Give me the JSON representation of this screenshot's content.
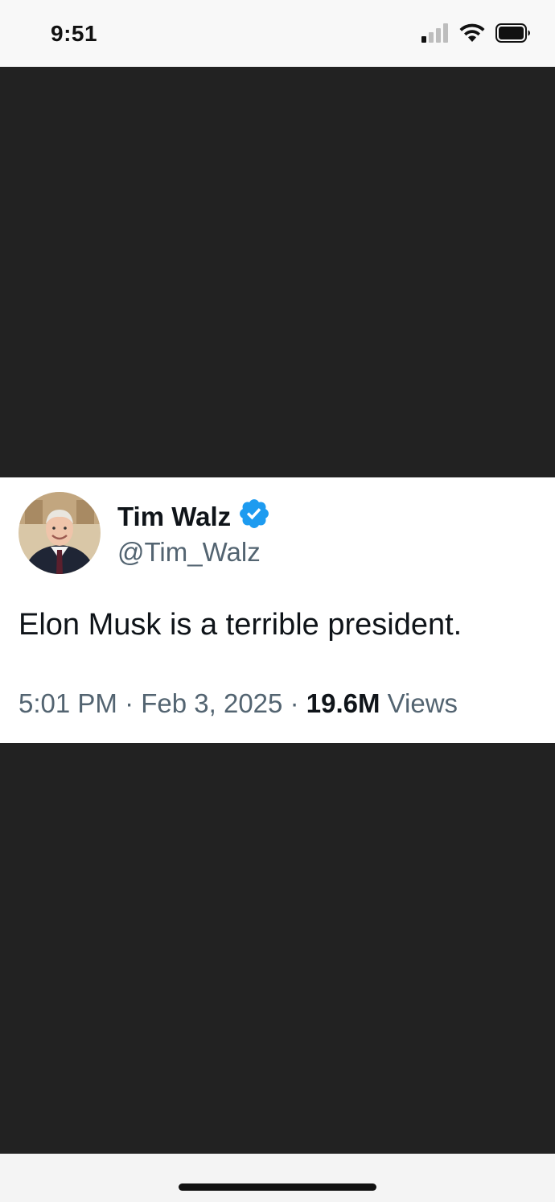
{
  "status_bar": {
    "time": "9:51",
    "signal_icon": "cellular-signal-icon",
    "wifi_icon": "wifi-icon",
    "battery_icon": "battery-icon"
  },
  "tweet": {
    "display_name": "Tim Walz",
    "verified_icon": "verified-badge-icon",
    "verified_color": "#1d9bf0",
    "handle": "@Tim_Walz",
    "text": "Elon Musk is a terrible president.",
    "time": "5:01 PM",
    "separator": "·",
    "date": "Feb 3, 2025",
    "views_count": "19.6M",
    "views_label": "Views"
  },
  "colors": {
    "background_dark": "#222222",
    "card_background": "#ffffff",
    "primary_text": "#0f1419",
    "secondary_text": "#536471"
  }
}
